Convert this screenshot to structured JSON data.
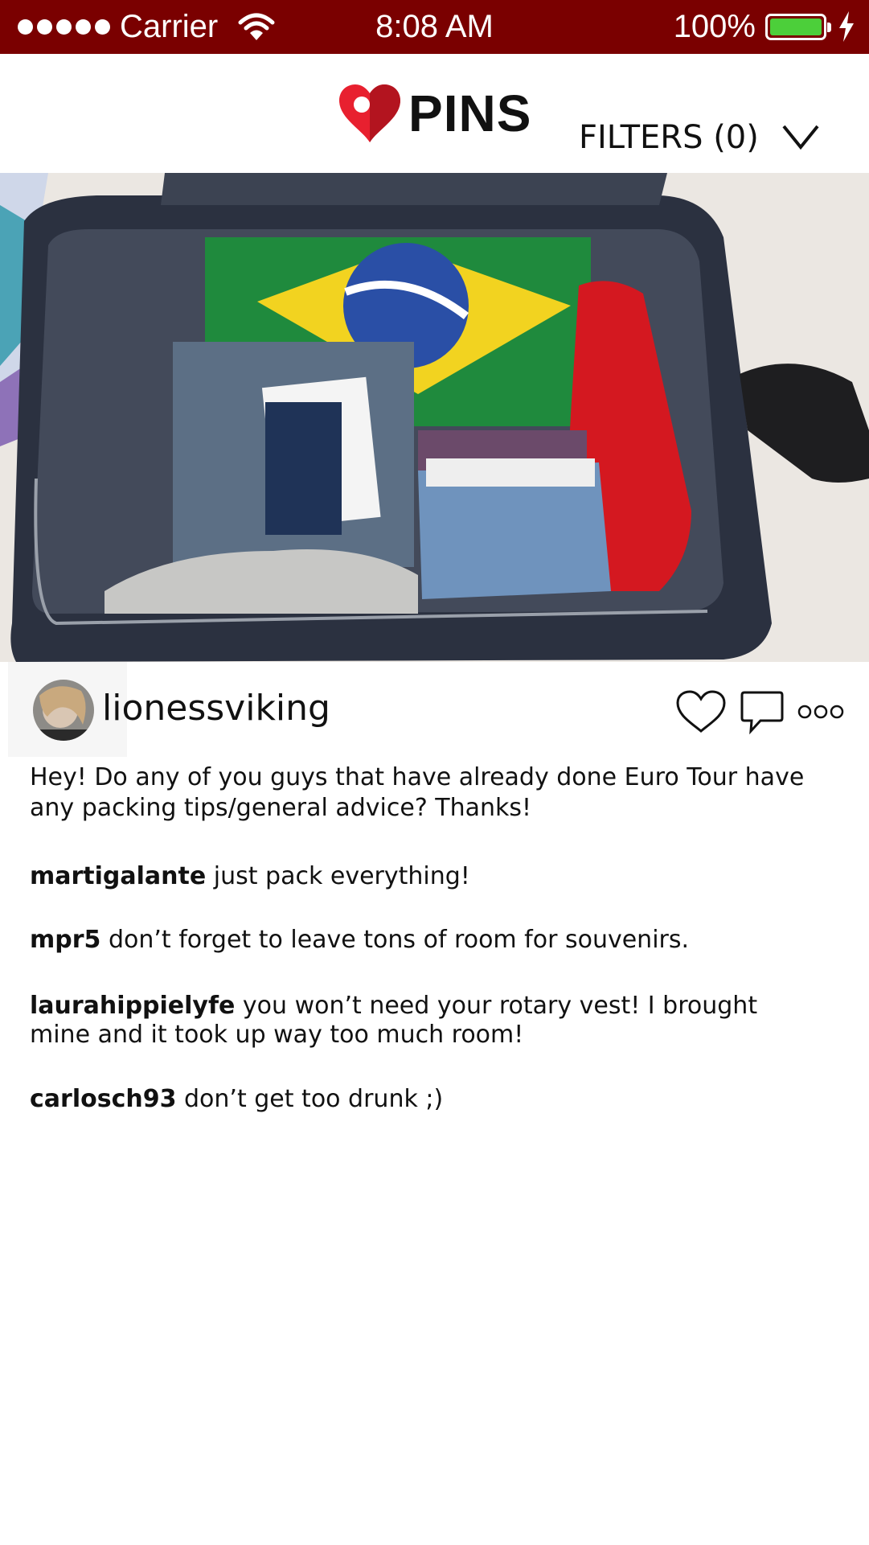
{
  "status_bar": {
    "carrier": "Carrier",
    "time": "8:08 AM",
    "battery": "100%",
    "signal_bars": 5,
    "icons": [
      "wifi-icon",
      "battery-icon",
      "charging-icon"
    ]
  },
  "header": {
    "logo_text": "PINS",
    "logo_icon": "map-pin-heart-icon",
    "filters_label": "FILTERS (0)",
    "filters_icon": "chevron-down-icon"
  },
  "post": {
    "image_description_icon": "photo",
    "username": "lionessviking",
    "caption": "Hey! Do any of you guys that have already done Euro Tour have any packing tips/general advice? Thanks!",
    "actions": [
      "heart-icon",
      "comment-icon",
      "more-icon"
    ]
  },
  "comments": [
    {
      "user": "martigalante",
      "text": " just pack everything!"
    },
    {
      "user": "mpr5",
      "text": " don’t forget to leave tons of room for souvenirs."
    },
    {
      "user": "laurahippielyfe",
      "text": " you won’t need your rotary vest! I brought mine and it took up way too much room!"
    },
    {
      "user": "carlosch93",
      "text": " don’t get too drunk ;)"
    }
  ],
  "colors": {
    "status_bar": "#7a0000",
    "brand_red": "#e8202f",
    "battery_green": "#4ccf3a"
  }
}
